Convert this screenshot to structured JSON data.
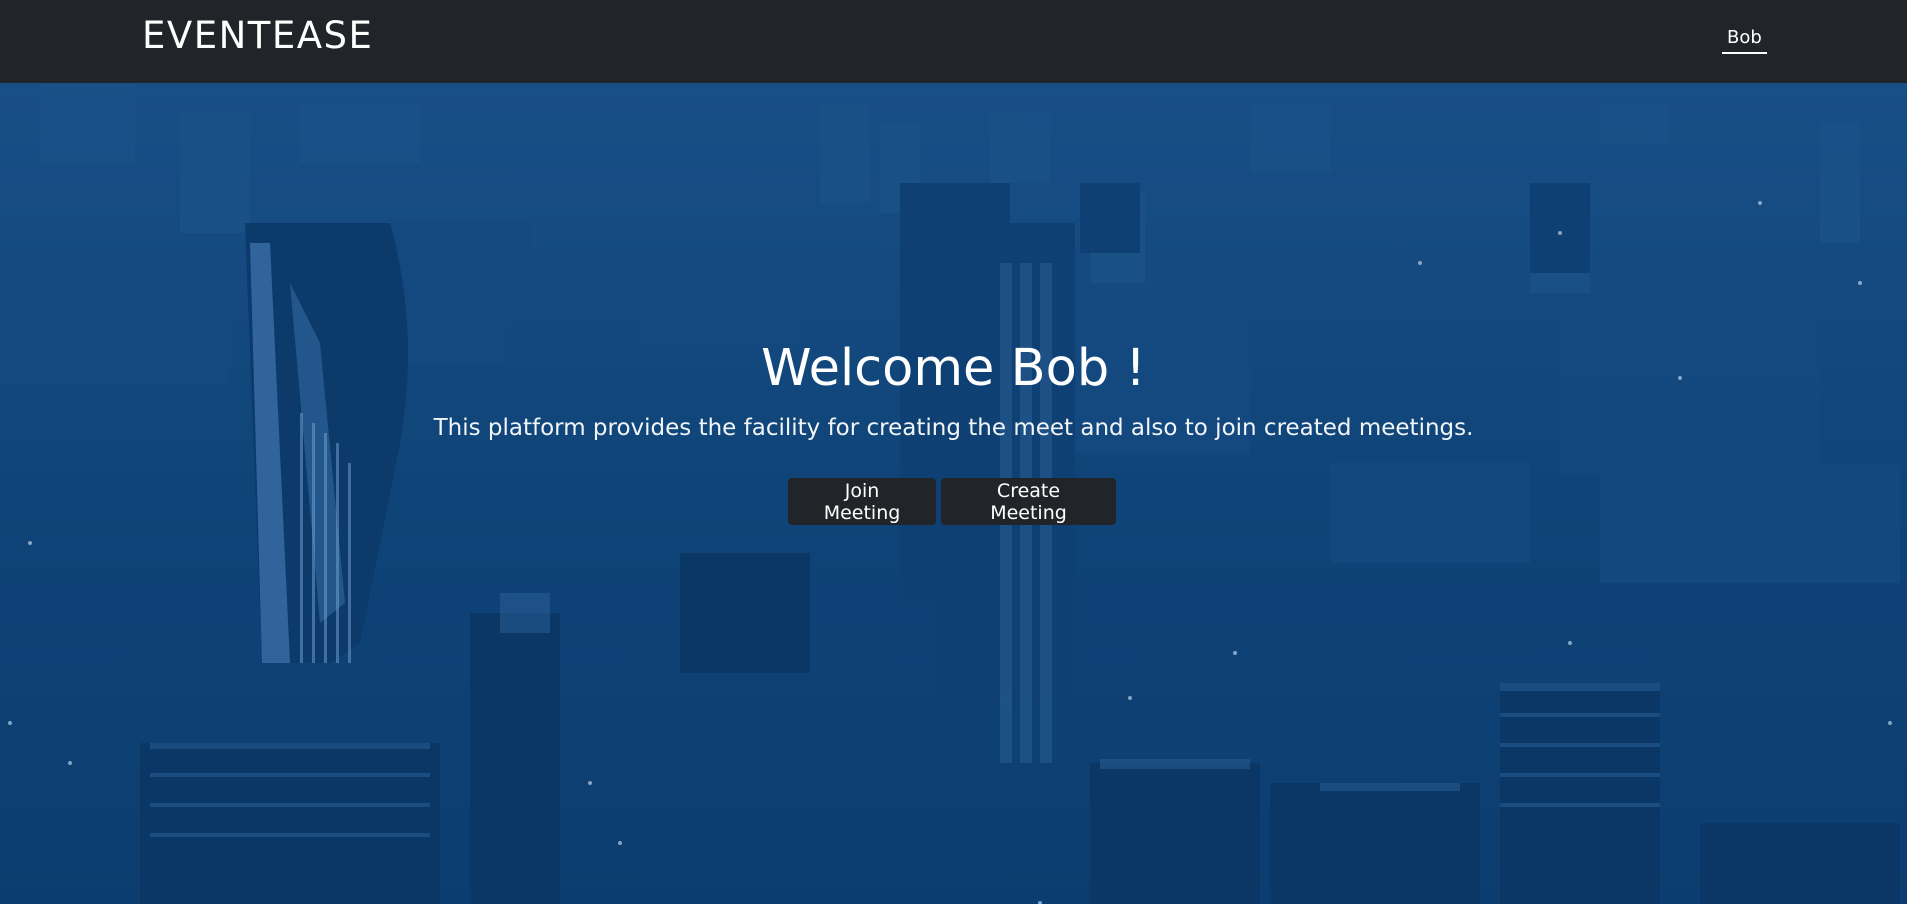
{
  "navbar": {
    "brand": "EVENTEASE",
    "user_link": "Bob"
  },
  "hero": {
    "title": "Welcome Bob !",
    "subtitle": "This platform provides the facility for creating the meet and also to join created meetings.",
    "buttons": {
      "join_label": "Join Meeting",
      "create_label": "Create Meeting"
    },
    "background": "city-skyline-image"
  },
  "colors": {
    "navbar_bg": "#212529",
    "hero_tint": "#0d4176",
    "button_bg": "#212529",
    "text": "#ffffff"
  }
}
